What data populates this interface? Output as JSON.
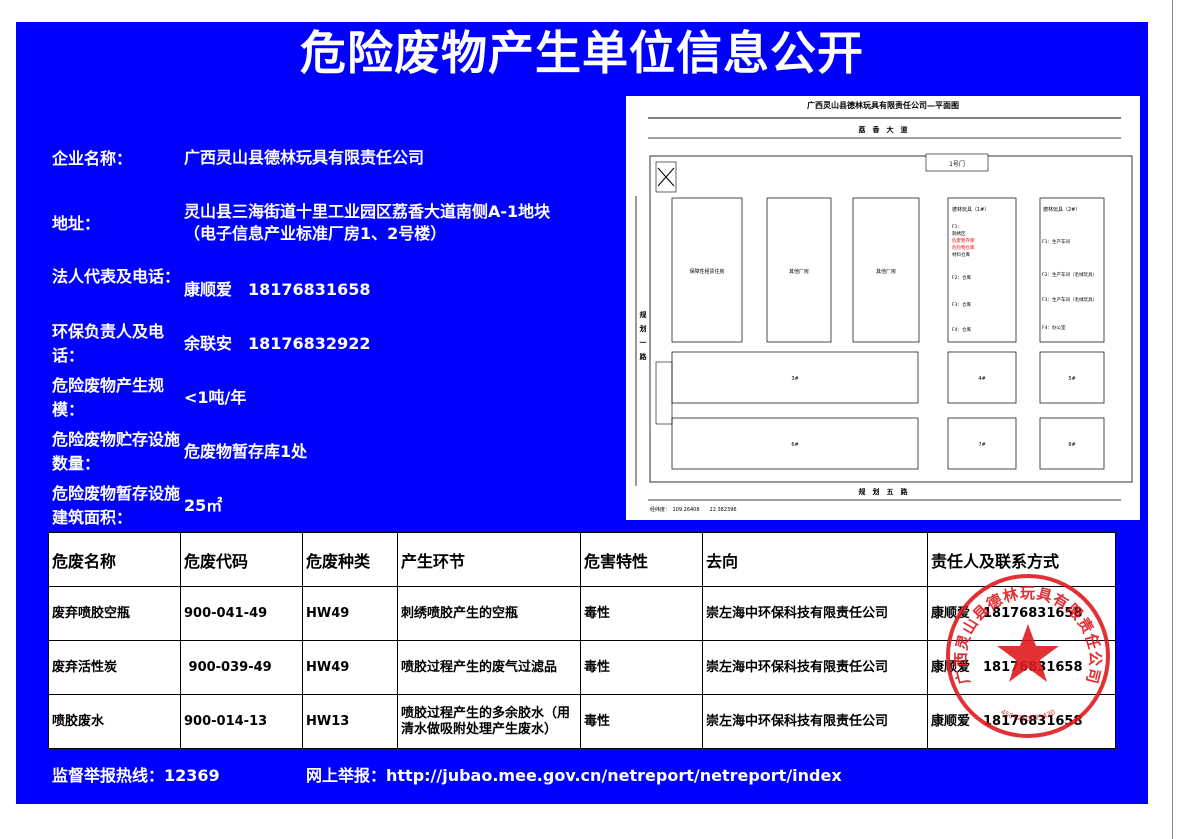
{
  "title": "危险废物产生单位信息公开",
  "info": [
    {
      "label": "企业名称：",
      "value": "广西灵山县德林玩具有限责任公司",
      "value2": ""
    },
    {
      "label": "地址：",
      "value": "灵山县三海街道十里工业园区荔香大道南侧A-1地块",
      "value2": "（电子信息产业标准厂房1、2号楼）"
    },
    {
      "label": "法人代表及电话：",
      "value": "康顺爱　18176831658",
      "value2": ""
    },
    {
      "label": "环保负责人及电话：",
      "value": "余联安　18176832922",
      "value2": ""
    },
    {
      "label": "危险废物产生规模：",
      "value": "<1吨/年",
      "value2": ""
    },
    {
      "label": "危险废物贮存设施数量：",
      "value": "危废物暂存库1处",
      "value2": ""
    },
    {
      "label": "危险废物暂存设施建筑面积：",
      "value": "25㎡",
      "value2": ""
    }
  ],
  "plan": {
    "title": "广西灵山县德林玩具有限责任公司—平面图",
    "road_top": "荔　香　大　道",
    "road_left": "规　划　一　路",
    "road_bottom": "规　划　五　路",
    "gate": "1号门",
    "buildings": [
      "保障性租赁住房",
      "其他厂房",
      "其他厂房"
    ],
    "building4_title": "德林玩具（1#）",
    "building4_lines": [
      "F1：",
      "刺绣区",
      "危废暂存库",
      "危险物仓库",
      "材料仓库",
      "F2：仓库",
      "F3：仓库",
      "F4：仓库"
    ],
    "building5_title": "德林玩具（2#）",
    "building5_lines": [
      "F1：生产车间",
      "F2：生产车间（毛绒玩具）",
      "F3：生产车间（毛绒玩具）",
      "F4：办公室"
    ],
    "blocks": [
      "3#",
      "4#",
      "5#",
      "6#",
      "7#",
      "8#"
    ],
    "coords": "经纬度：　109.26408　　22.382396"
  },
  "table": {
    "headers": [
      "危废名称",
      "危废代码",
      "危废种类",
      "产生环节",
      "危害特性",
      "去向",
      "责任人及联系方式"
    ],
    "rows": [
      [
        "废弃喷胶空瓶",
        "900-041-49",
        "HW49",
        "刺绣喷胶产生的空瓶",
        "毒性",
        "崇左海中环保科技有限责任公司",
        "康顺爱　18176831658"
      ],
      [
        "废弃活性炭",
        " 900-039-49",
        "HW49",
        "喷胶过程产生的废气过滤品",
        "毒性",
        "崇左海中环保科技有限责任公司",
        "康顺爱　18176831658"
      ],
      [
        "喷胶废水",
        "900-014-13",
        "HW13",
        "喷胶过程产生的多余胶水（用清水做吸附处理产生废水）",
        "毒性",
        "崇左海中环保科技有限责任公司",
        "康顺爱　18176831658"
      ]
    ]
  },
  "footer": {
    "hotline": "监督举报热线：12369",
    "online": "网上举报：http://jubao.mee.gov.cn/netreport/netreport/index"
  },
  "stamp": {
    "text": "广西灵山县德林玩具有限责任公司",
    "code": "4507210025430"
  },
  "colors": {
    "board": "#0000ff",
    "stamp": "#e0191e",
    "plan_hazard": "#ff0000"
  }
}
